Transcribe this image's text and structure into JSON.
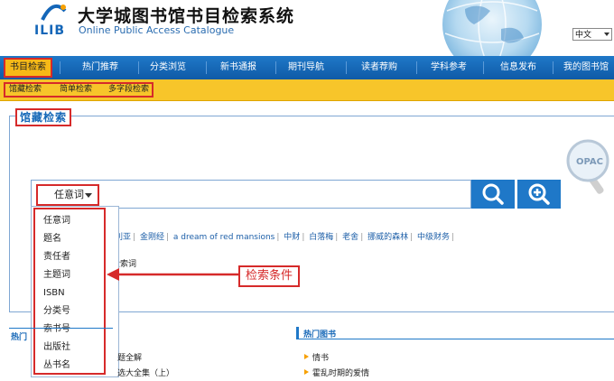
{
  "header": {
    "logo_text": "ILIB",
    "title_cn": "大学城图书馆书目检索系统",
    "title_en": "Online Public Access Catalogue",
    "language": "中文"
  },
  "nav": {
    "items": [
      "书目检索",
      "热门推荐",
      "分类浏览",
      "新书通报",
      "期刊导航",
      "读者荐购",
      "学科参考",
      "信息发布",
      "我的图书馆"
    ]
  },
  "subnav": {
    "items": [
      "馆藏检索",
      "简单检索",
      "多字段检索"
    ]
  },
  "panel": {
    "title": "馆藏检索"
  },
  "search": {
    "selected_field": "任意词",
    "options": [
      "任意词",
      "题名",
      "责任者",
      "主题词",
      "ISBN",
      "分类号",
      "索书号",
      "出版社",
      "丛书名"
    ],
    "hot_words": [
      "亚利亚",
      "金刚经",
      "a dream of red mansions",
      "中财",
      "白落梅",
      "老舍",
      "挪威的森林",
      "中级财务"
    ],
    "context_text": "检索词"
  },
  "annotation": {
    "label": "检索条件"
  },
  "bottom": {
    "left_title": "热门",
    "left_items": [
      "题全解",
      "选大全集（上）"
    ],
    "right_title": "热门图书",
    "right_items": [
      "情书",
      "霍乱时期的爱情"
    ]
  },
  "colors": {
    "nav_blue": "#1f78c8",
    "subnav_yellow": "#f7c52a",
    "annotation_red": "#d62a2a"
  }
}
